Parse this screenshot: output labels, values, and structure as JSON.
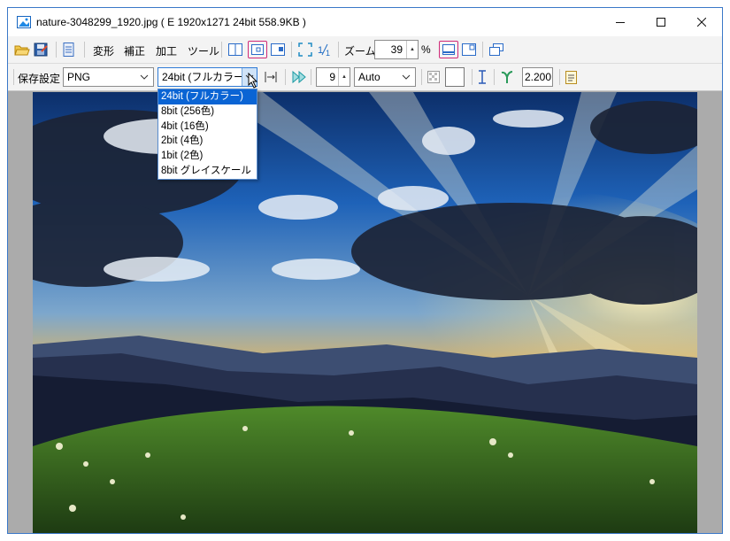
{
  "title": "nature-3048299_1920.jpg  ( E  1920x1271  24bit  558.9KB )",
  "menus": [
    "変形",
    "補正",
    "加工",
    "ツール"
  ],
  "zoom": {
    "label": "ズーム:",
    "value": "39",
    "unit": "%"
  },
  "save": {
    "label": "保存設定",
    "format": "PNG",
    "depth": "24bit (フルカラー)",
    "depth_options": [
      "24bit (フルカラー)",
      "8bit (256色)",
      "4bit (16色)",
      "2bit (4色)",
      "1bit (2色)",
      "8bit グレイスケール"
    ],
    "compress": "9",
    "mode": "Auto",
    "gamma": "2.200"
  },
  "icons": [
    "open-folder-icon",
    "save-icon",
    "document-icon",
    "layout-icon",
    "fit-icon",
    "sidebar-icon",
    "fullscreen-icon",
    "one-to-one-icon",
    "minimize-window-icon",
    "maximize-window-icon",
    "close-window-icon"
  ]
}
